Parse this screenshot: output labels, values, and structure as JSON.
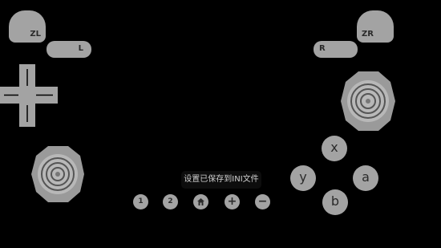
{
  "triggers": {
    "zl_label": "ZL",
    "zr_label": "ZR"
  },
  "shoulders": {
    "l_label": "L",
    "r_label": "R"
  },
  "face_buttons": {
    "x": "x",
    "y": "y",
    "a": "a",
    "b": "b"
  },
  "small_buttons": {
    "one": "1",
    "two": "2",
    "plus": "+",
    "minus": "−"
  },
  "toast": {
    "message": "设置已保存到INI文件"
  },
  "icons": {
    "dpad": "dpad-icon",
    "left_stick": "left-stick-icon",
    "right_stick": "right-stick-icon",
    "home": "home-icon"
  },
  "colors": {
    "control": "#a3a3a3",
    "background": "#000000",
    "toast_bg": "#0d0d0d"
  }
}
